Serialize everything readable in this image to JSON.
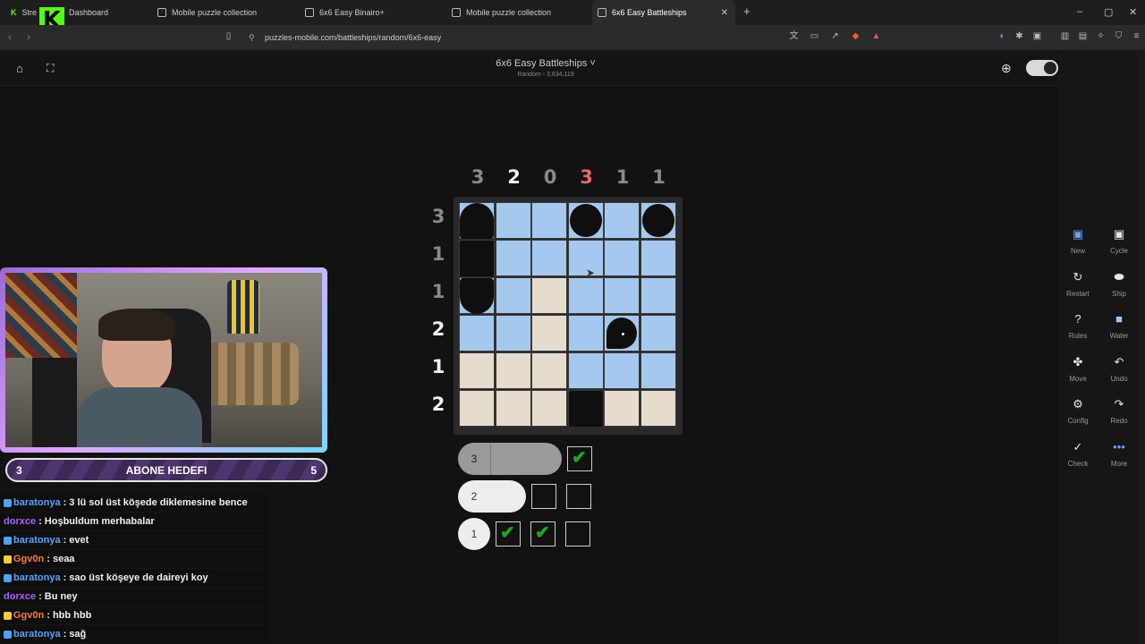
{
  "browser": {
    "tabs": [
      {
        "label": "Stre",
        "extra": "Dashboard"
      },
      {
        "label": "Mobile puzzle collection"
      },
      {
        "label": "6x6 Easy Binairo+"
      },
      {
        "label": "Mobile puzzle collection"
      },
      {
        "label": "6x6 Easy Battleships",
        "active": true
      }
    ],
    "url": "puzzles-mobile.com/battleships/random/6x6-easy"
  },
  "header": {
    "title": "6x6 Easy Battleships ˅",
    "subtitle": "Random - 3,634,119"
  },
  "grid": {
    "col_clues": [
      {
        "v": "3",
        "color": "#8a8a8a"
      },
      {
        "v": "2",
        "color": "#f2f2f2"
      },
      {
        "v": "0",
        "color": "#8a8a8a"
      },
      {
        "v": "3",
        "color": "#e46a6a"
      },
      {
        "v": "1",
        "color": "#8a8a8a"
      },
      {
        "v": "1",
        "color": "#8a8a8a"
      }
    ],
    "row_clues": [
      {
        "v": "3",
        "color": "#8a8a8a"
      },
      {
        "v": "1",
        "color": "#8a8a8a"
      },
      {
        "v": "1",
        "color": "#8a8a8a"
      },
      {
        "v": "2",
        "color": "#f2f2f2"
      },
      {
        "v": "1",
        "color": "#f2f2f2"
      },
      {
        "v": "2",
        "color": "#f2f2f2"
      }
    ],
    "cells": [
      [
        "ship-top",
        "water",
        "water",
        "ship-circle",
        "water",
        "ship-circle"
      ],
      [
        "ship-sq",
        "water",
        "water",
        "water",
        "water",
        "water"
      ],
      [
        "ship-bot",
        "water",
        "sand",
        "water",
        "water",
        "water"
      ],
      [
        "water",
        "water",
        "sand",
        "water",
        "ship-unk",
        "water"
      ],
      [
        "sand",
        "sand",
        "sand",
        "water",
        "water",
        "water"
      ],
      [
        "sand",
        "sand",
        "sand",
        "ship-sq",
        "sand",
        "sand"
      ]
    ]
  },
  "fleet": [
    {
      "size": "3",
      "segments": 2,
      "boxes": [
        "check"
      ]
    },
    {
      "size": "2",
      "segments": 1,
      "boxes": [
        "empty",
        "empty"
      ]
    },
    {
      "size": "1",
      "segments": 0,
      "boxes": [
        "check",
        "check",
        "empty"
      ]
    }
  ],
  "toolbar": [
    {
      "label": "New",
      "icon": "new-icon",
      "glyph": "▣",
      "color": "#6ea0ff"
    },
    {
      "label": "Cycle",
      "icon": "cycle-icon",
      "glyph": "▣",
      "color": "#e6e6e6"
    },
    {
      "label": "Restart",
      "icon": "restart-icon",
      "glyph": "↻",
      "color": "#e6e6e6"
    },
    {
      "label": "Ship",
      "icon": "ship-icon",
      "glyph": "⬬",
      "color": "#e6e6e6"
    },
    {
      "label": "Rules",
      "icon": "rules-icon",
      "glyph": "?",
      "color": "#e6e6e6"
    },
    {
      "label": "Water",
      "icon": "water-icon",
      "glyph": "■",
      "color": "#a5c9ee"
    },
    {
      "label": "Move",
      "icon": "move-icon",
      "glyph": "✤",
      "color": "#e6e6e6"
    },
    {
      "label": "Undo",
      "icon": "undo-icon",
      "glyph": "↶",
      "color": "#e6e6e6"
    },
    {
      "label": "Config",
      "icon": "config-icon",
      "glyph": "⚙",
      "color": "#e6e6e6"
    },
    {
      "label": "Redo",
      "icon": "redo-icon",
      "glyph": "↷",
      "color": "#e6e6e6"
    },
    {
      "label": "Check",
      "icon": "check-icon",
      "glyph": "✓",
      "color": "#e6e6e6"
    },
    {
      "label": "More",
      "icon": "more-icon",
      "glyph": "•••",
      "color": "#6ea0ff"
    }
  ],
  "stream": {
    "goal_left": "3",
    "goal_title": "ABONE HEDEFI",
    "goal_right": "5",
    "chat": [
      {
        "user": "baratonya",
        "color": "#5ea1ff",
        "badge": "#4aa3ff",
        "msg": ": 3 lü sol üst köşede diklemesine bence"
      },
      {
        "user": "dorxce",
        "color": "#b05cff",
        "badge": "",
        "msg": ": Hoşbuldum merhabalar"
      },
      {
        "user": "baratonya",
        "color": "#5ea1ff",
        "badge": "#4aa3ff",
        "msg": ": evet"
      },
      {
        "user": "Ggv0n",
        "color": "#ff7a3d",
        "badge": "#ffc83d",
        "msg": ": seaa"
      },
      {
        "user": "baratonya",
        "color": "#5ea1ff",
        "badge": "#4aa3ff",
        "msg": ": sao üst köşeye de daireyi koy"
      },
      {
        "user": "dorxce",
        "color": "#b05cff",
        "badge": "",
        "msg": ": Bu ney"
      },
      {
        "user": "Ggv0n",
        "color": "#ff7a3d",
        "badge": "#ffc83d",
        "msg": ": hbb hbb"
      },
      {
        "user": "baratonya",
        "color": "#5ea1ff",
        "badge": "#4aa3ff",
        "msg": ": sağ"
      }
    ]
  }
}
